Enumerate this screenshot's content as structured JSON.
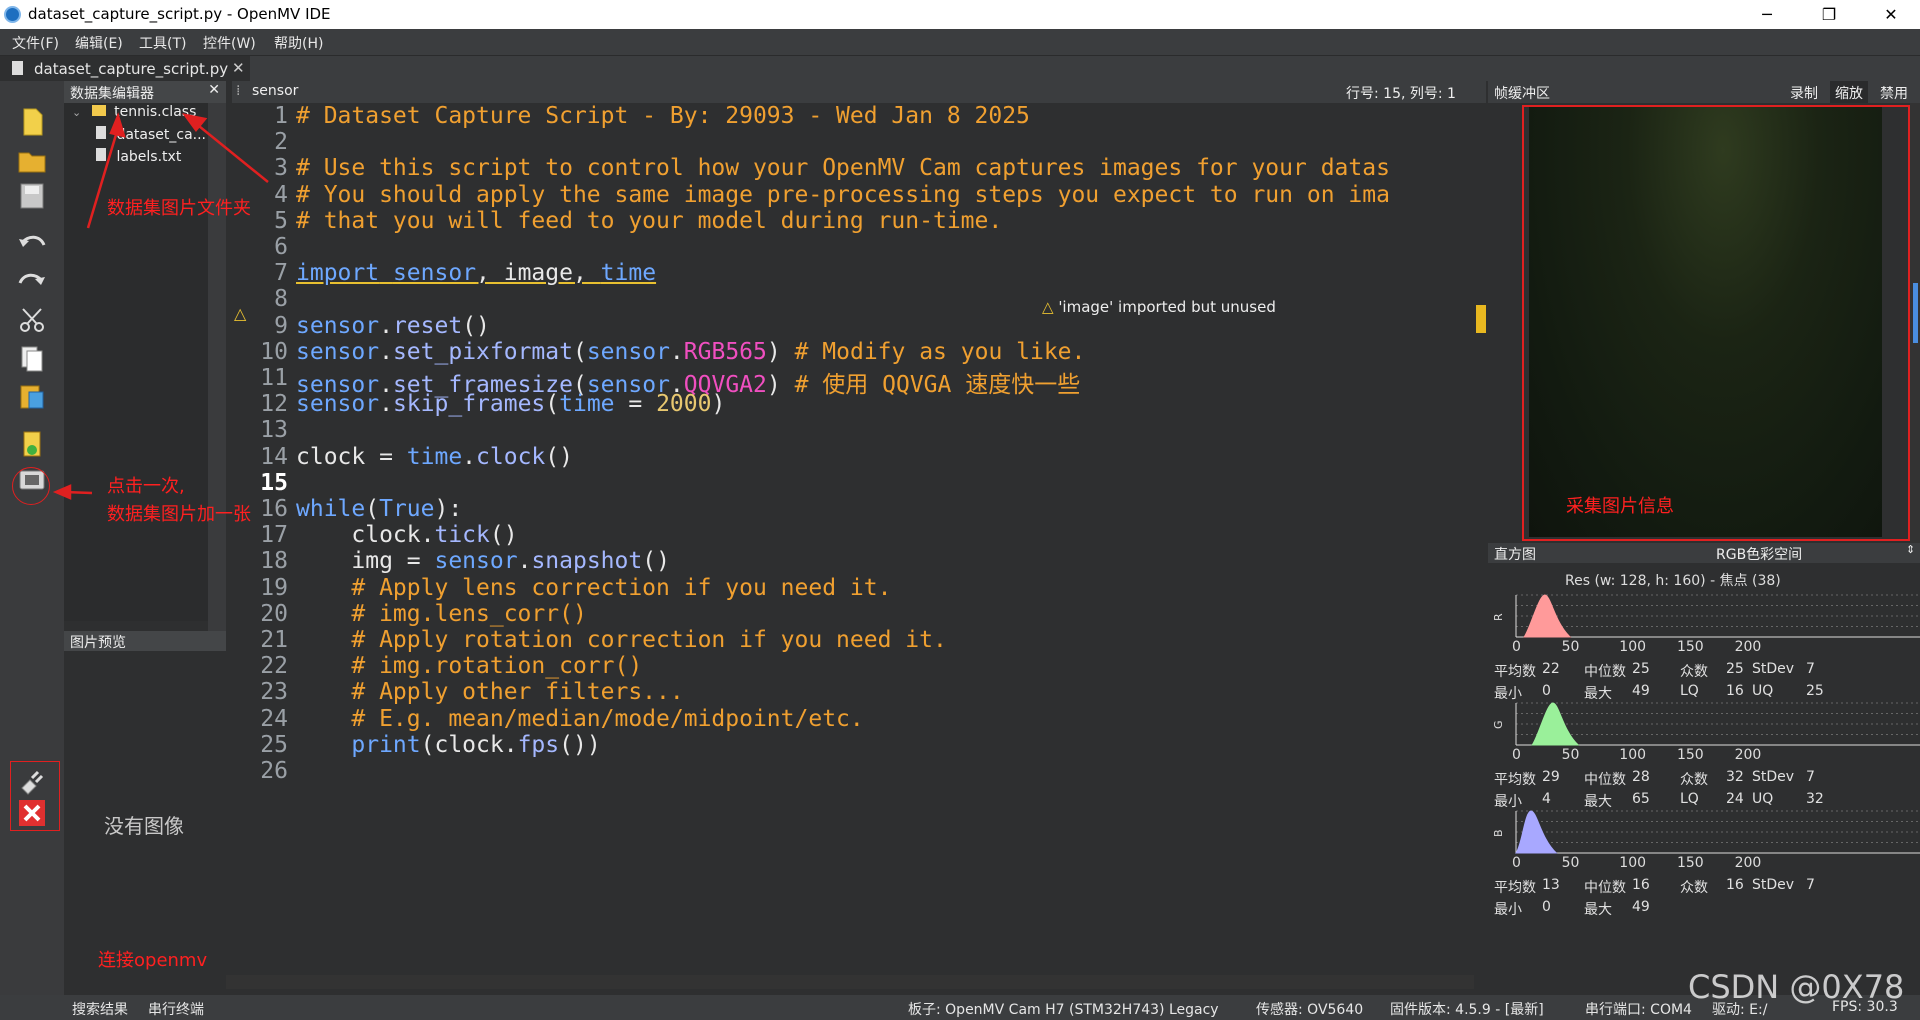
{
  "window": {
    "title": "dataset_capture_script.py - OpenMV IDE",
    "min": "─",
    "restore": "❐",
    "close": "✕"
  },
  "menu": [
    "文件(F)",
    "编辑(E)",
    "工具(T)",
    "控件(W)",
    "帮助(H)"
  ],
  "file_tab": {
    "label": "dataset_capture_script.py",
    "close": "✕"
  },
  "dataset_panel": {
    "title": "数据集编辑器",
    "close": "✕",
    "tree": [
      {
        "label": "tennis.class",
        "type": "folder"
      },
      {
        "label": "dataset_ca...",
        "type": "file"
      },
      {
        "label": "labels.txt",
        "type": "file"
      }
    ]
  },
  "preview": {
    "title": "图片预览",
    "empty": "没有图像"
  },
  "editor": {
    "file": "sensor",
    "position": "行号: 15, 列号: 1",
    "warning": "'image' imported but unused",
    "lines": [
      "# Dataset Capture Script - By: 29093 - Wed Jan 8 2025",
      "",
      "# Use this script to control how your OpenMV Cam captures images for your datas",
      "# You should apply the same image pre-processing steps you expect to run on ima",
      "# that you will feed to your model during run-time.",
      "",
      "import sensor, image, time",
      "",
      "sensor.reset()",
      "sensor.set_pixformat(sensor.RGB565) # Modify as you like.",
      "sensor.set_framesize(sensor.QQVGA2) # 使用 QQVGA 速度快一些",
      "sensor.skip_frames(time = 2000)",
      "",
      "clock = time.clock()",
      "",
      "while(True):",
      "    clock.tick()",
      "    img = sensor.snapshot()",
      "    # Apply lens correction if you need it.",
      "    # img.lens_corr()",
      "    # Apply rotation correction if you need it.",
      "    # img.rotation_corr()",
      "    # Apply other filters...",
      "    # E.g. mean/median/mode/midpoint/etc.",
      "    print(clock.fps())",
      ""
    ]
  },
  "framebuffer": {
    "title": "帧缓冲区",
    "record": "录制",
    "zoom": "缩放",
    "disable": "禁用"
  },
  "histogram": {
    "title": "直方图",
    "colorspace": "RGB色彩空间",
    "res": "Res  (w: 128,  h: 160) - 焦点 (38)",
    "axis": [
      "0",
      "50",
      "100",
      "150",
      "200"
    ],
    "channels": [
      {
        "name": "R",
        "color": "#ff9a9a",
        "peak_at": 25,
        "peak": 1.0,
        "mean": "22",
        "median": "25",
        "mode": "25",
        "stdev": "7",
        "min": "0",
        "max": "49",
        "lq": "16",
        "uq": "25"
      },
      {
        "name": "G",
        "color": "#9af09a",
        "peak_at": 32,
        "peak": 1.0,
        "mean": "29",
        "median": "28",
        "mode": "32",
        "stdev": "7",
        "min": "4",
        "max": "65",
        "lq": "24",
        "uq": "32"
      },
      {
        "name": "B",
        "color": "#a8a8ff",
        "peak_at": 13,
        "peak": 1.0,
        "mean": "13",
        "median": "16",
        "mode": "16",
        "stdev": "7",
        "min": "0",
        "max": "49",
        "lq": "",
        "uq": ""
      }
    ],
    "labels": {
      "mean": "平均数",
      "median": "中位数",
      "mode": "众数",
      "stdev": "StDev",
      "min": "最小",
      "max": "最大",
      "lq": "LQ",
      "uq": "UQ"
    }
  },
  "status": {
    "search": "搜索结果",
    "serial_term": "串行终端",
    "board": "板子: OpenMV Cam H7 (STM32H743) Legacy",
    "sensor": "传感器: OV5640",
    "firmware": "固件版本: 4.5.9 - [最新]",
    "port": "串行端口: COM4",
    "drive": "驱动: E:/",
    "fps": "FPS: 30.3"
  },
  "annotations": {
    "folder": "数据集图片文件夹",
    "click_line1": "点击一次,",
    "click_line2": "数据集图片加一张",
    "connect": "连接openmv",
    "capture_info": "采集图片信息",
    "watermark": "CSDN @0X78"
  }
}
